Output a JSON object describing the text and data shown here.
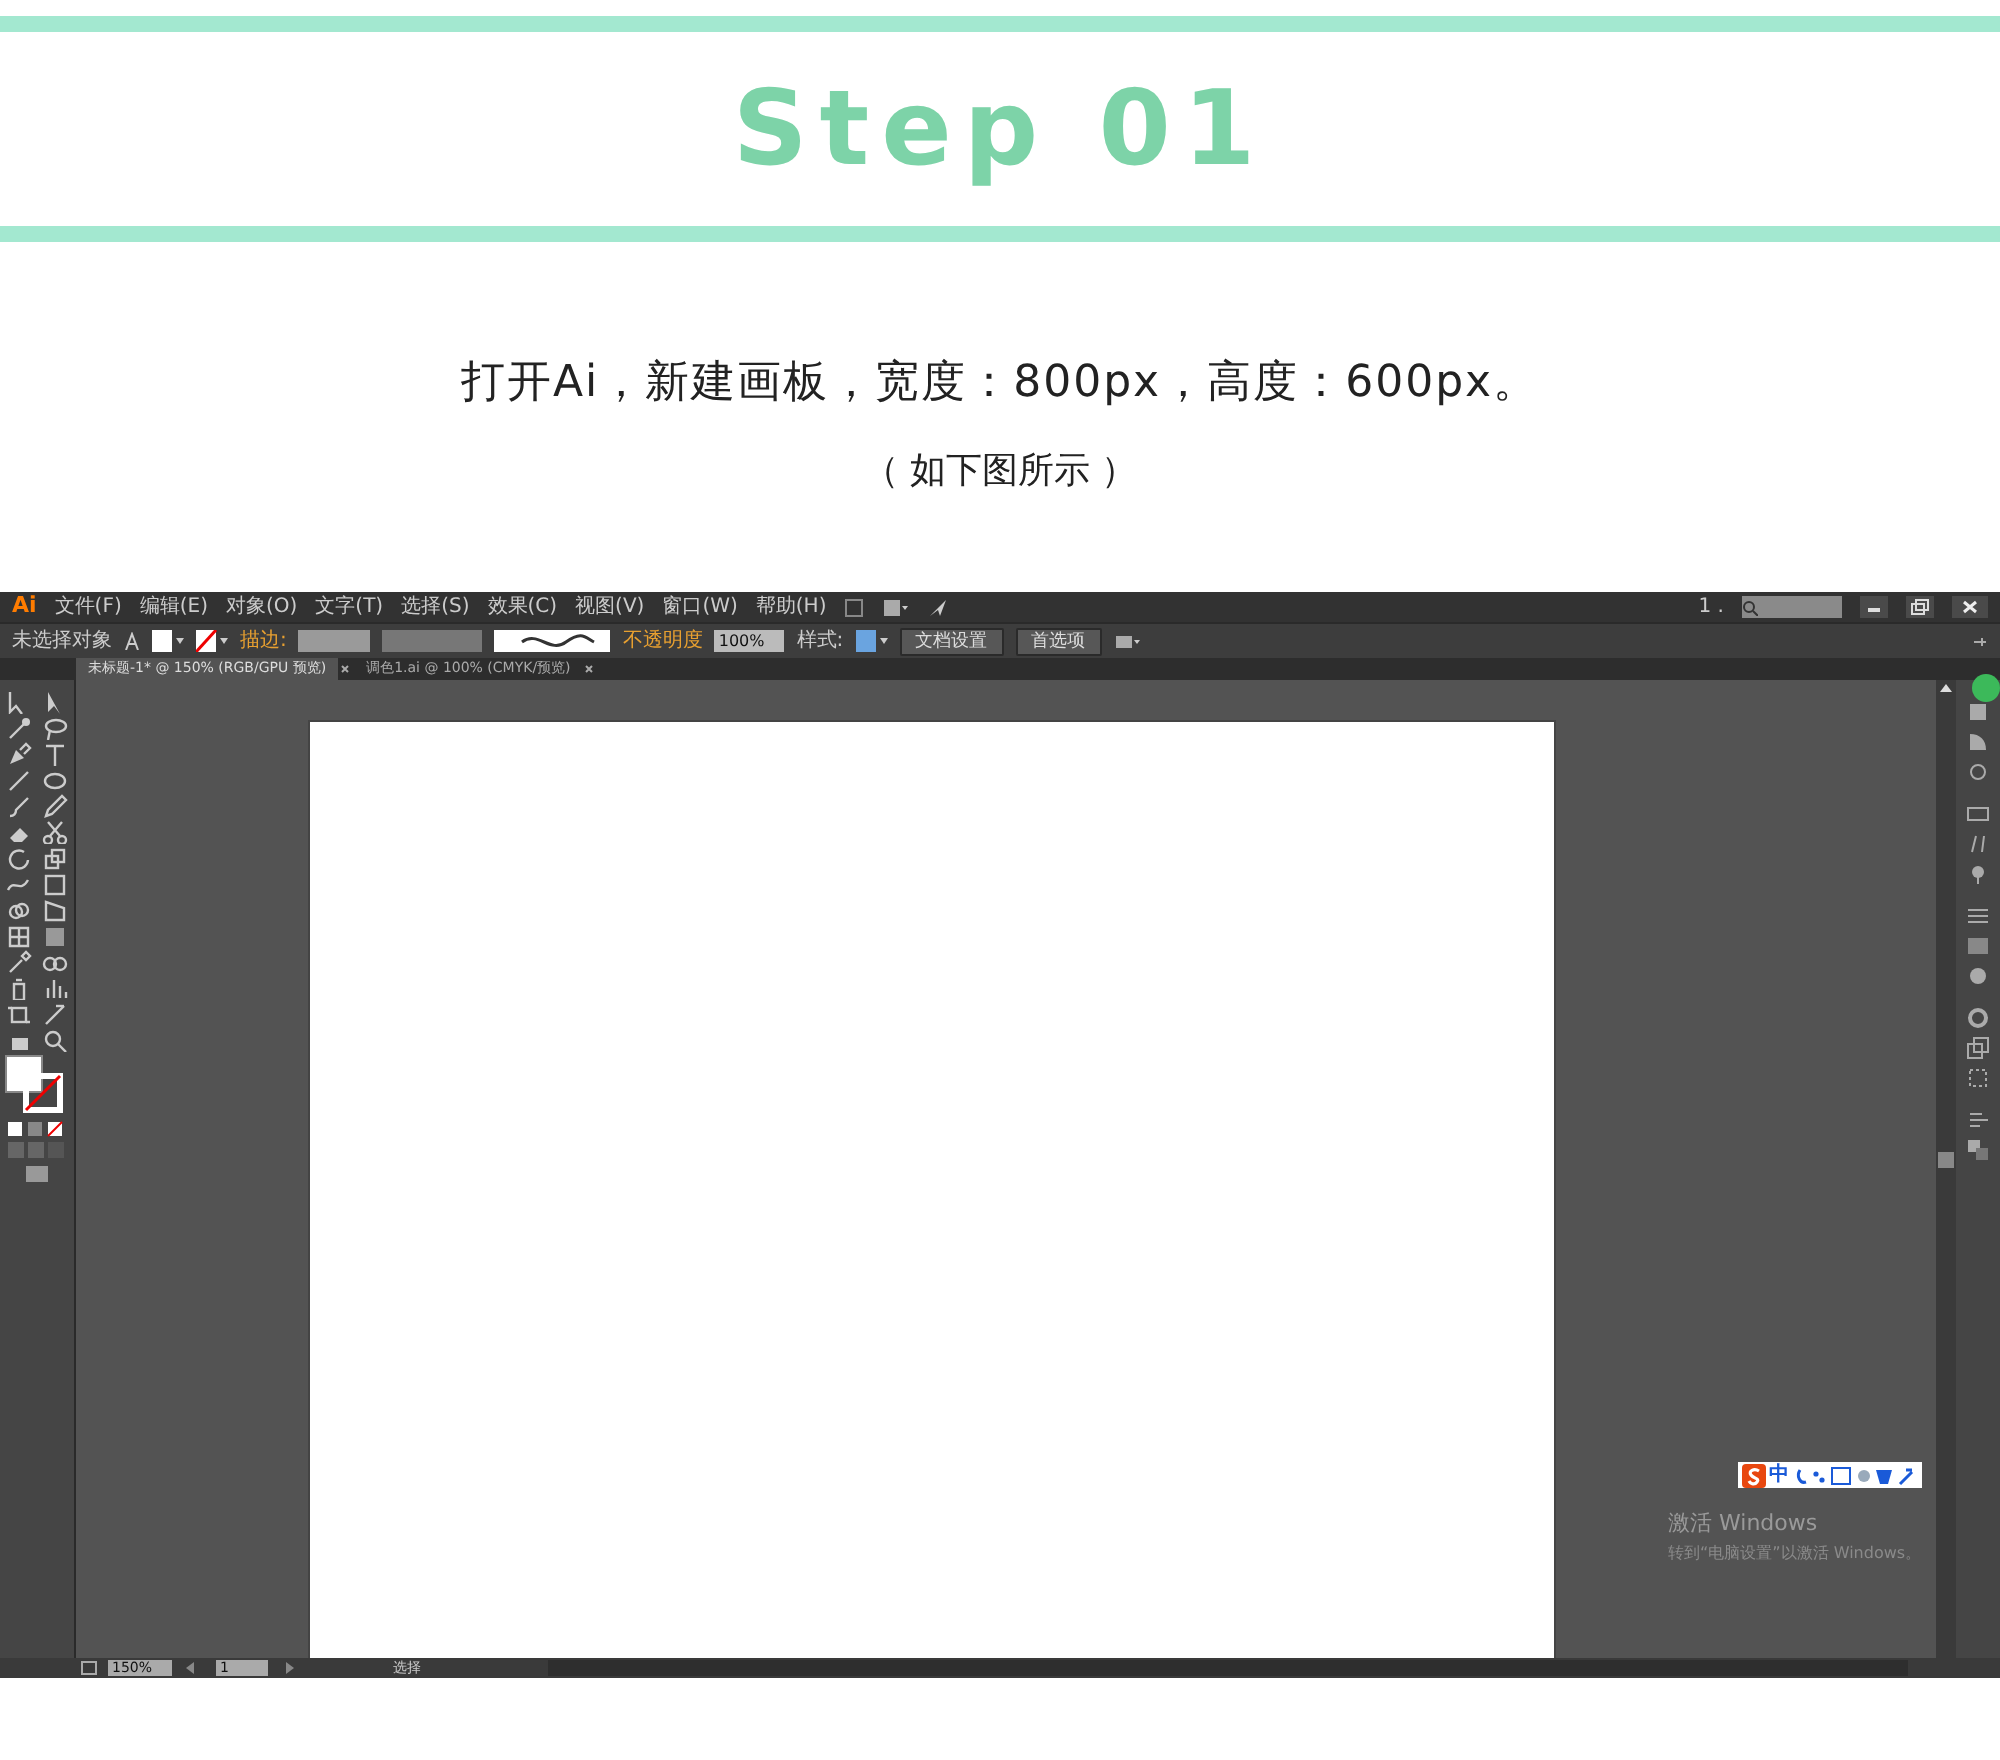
{
  "header": {
    "title": "Step 01"
  },
  "instructions": {
    "text": "打开Ai，新建画板，宽度：800px，高度：600px。",
    "note": "（ 如下图所示 ）"
  },
  "app": {
    "logo": "Ai",
    "menus": [
      "文件(F)",
      "编辑(E)",
      "对象(O)",
      "文字(T)",
      "选择(S)",
      "效果(C)",
      "视图(V)",
      "窗口(W)",
      "帮助(H)"
    ],
    "arrange_label": "1 .",
    "control_bar": {
      "selection": "未选择对象",
      "stroke_label": "描边:",
      "opacity_label": "不透明度",
      "opacity_value": "100%",
      "style_label": "样式:",
      "buttons": [
        "文档设置",
        "首选项"
      ]
    },
    "tabs": [
      {
        "label": "未标题-1* @ 150% (RGB/GPU 预览)",
        "selected": true
      },
      {
        "label": "调色1.ai @ 100% (CMYK/预览)",
        "selected": false
      }
    ],
    "status_bar": {
      "zoom": "150%",
      "artboard": "1",
      "tool": "选择"
    },
    "ime": {
      "mode": "中"
    },
    "activation": {
      "title": "激活 Windows",
      "message": "转到“电脑设置”以激活 Windows。"
    }
  }
}
